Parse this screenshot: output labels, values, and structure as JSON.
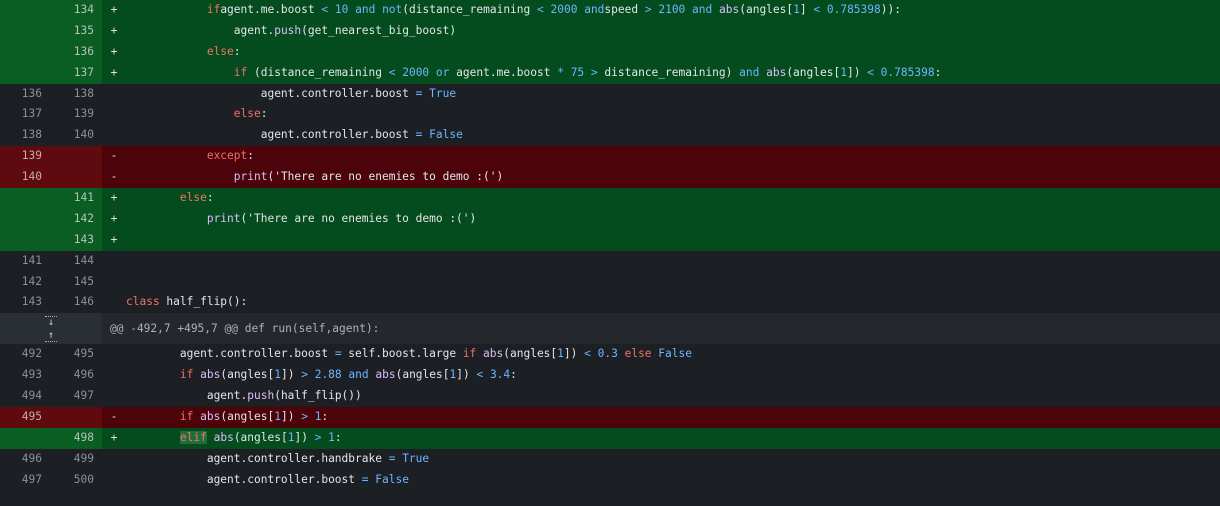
{
  "diff": {
    "rows": [
      {
        "type": "add",
        "old": "",
        "new": "134",
        "mark": "+",
        "ind": "            ",
        "toks": [
          [
            "kw",
            "if"
          ],
          [
            "",
            "agent.me.boost "
          ],
          [
            "op",
            "<"
          ],
          [
            "",
            " "
          ],
          [
            "num",
            "10"
          ],
          [
            "",
            " "
          ],
          [
            "op",
            "and"
          ],
          [
            "",
            " "
          ],
          [
            "op",
            "not"
          ],
          [
            "",
            "(distance_remaining "
          ],
          [
            "op",
            "<"
          ],
          [
            "",
            " "
          ],
          [
            "num",
            "2000"
          ],
          [
            "",
            " "
          ],
          [
            "op",
            "and"
          ],
          [
            "",
            "speed "
          ],
          [
            "op",
            ">"
          ],
          [
            "",
            " "
          ],
          [
            "num",
            "2100"
          ],
          [
            "",
            " "
          ],
          [
            "op",
            "and"
          ],
          [
            "",
            " "
          ],
          [
            "fn",
            "abs"
          ],
          [
            "",
            "(angles["
          ],
          [
            "num",
            "1"
          ],
          [
            "",
            "] "
          ],
          [
            "op",
            "<"
          ],
          [
            "",
            " "
          ],
          [
            "num",
            "0.785398"
          ],
          [
            "",
            "))"
          ],
          [
            "",
            ":"
          ]
        ]
      },
      {
        "type": "add",
        "old": "",
        "new": "135",
        "mark": "+",
        "ind": "                ",
        "toks": [
          [
            "",
            "agent."
          ],
          [
            "fn",
            "push"
          ],
          [
            "",
            "(get_nearest_big_boost)"
          ]
        ]
      },
      {
        "type": "add",
        "old": "",
        "new": "136",
        "mark": "+",
        "ind": "            ",
        "toks": [
          [
            "kw",
            "else"
          ],
          [
            "",
            ":"
          ]
        ]
      },
      {
        "type": "add",
        "old": "",
        "new": "137",
        "mark": "+",
        "ind": "                ",
        "toks": [
          [
            "kw",
            "if"
          ],
          [
            "",
            " (distance_remaining "
          ],
          [
            "op",
            "<"
          ],
          [
            "",
            " "
          ],
          [
            "num",
            "2000"
          ],
          [
            "",
            " "
          ],
          [
            "op",
            "or"
          ],
          [
            "",
            " agent.me.boost "
          ],
          [
            "op",
            "*"
          ],
          [
            "",
            " "
          ],
          [
            "num",
            "75"
          ],
          [
            "",
            " "
          ],
          [
            "op",
            ">"
          ],
          [
            "",
            " distance_remaining) "
          ],
          [
            "op",
            "and"
          ],
          [
            "",
            " "
          ],
          [
            "fn",
            "abs"
          ],
          [
            "",
            "(angles["
          ],
          [
            "num",
            "1"
          ],
          [
            "",
            "]) "
          ],
          [
            "op",
            "<"
          ],
          [
            "",
            " "
          ],
          [
            "num",
            "0.785398"
          ],
          [
            "",
            ":"
          ]
        ]
      },
      {
        "type": "ctx",
        "old": "136",
        "new": "138",
        "mark": "",
        "ind": "                    ",
        "toks": [
          [
            "",
            "agent.controller.boost "
          ],
          [
            "op",
            "="
          ],
          [
            "",
            " "
          ],
          [
            "op",
            "True"
          ]
        ]
      },
      {
        "type": "ctx",
        "old": "137",
        "new": "139",
        "mark": "",
        "ind": "                ",
        "toks": [
          [
            "kw",
            "else"
          ],
          [
            "",
            ":"
          ]
        ]
      },
      {
        "type": "ctx",
        "old": "138",
        "new": "140",
        "mark": "",
        "ind": "                    ",
        "toks": [
          [
            "",
            "agent.controller.boost "
          ],
          [
            "op",
            "="
          ],
          [
            "",
            " "
          ],
          [
            "op",
            "False"
          ]
        ]
      },
      {
        "type": "del",
        "old": "139",
        "new": "",
        "mark": "-",
        "ind": "            ",
        "toks": [
          [
            "kw",
            "except"
          ],
          [
            "",
            ":"
          ]
        ]
      },
      {
        "type": "del",
        "old": "140",
        "new": "",
        "mark": "-",
        "ind": "                ",
        "toks": [
          [
            "fn",
            "print"
          ],
          [
            "",
            "('There are no enemies to demo :(')"
          ]
        ]
      },
      {
        "type": "add",
        "old": "",
        "new": "141",
        "mark": "+",
        "ind": "        ",
        "toks": [
          [
            "kw",
            "else"
          ],
          [
            "",
            ":"
          ]
        ]
      },
      {
        "type": "add",
        "old": "",
        "new": "142",
        "mark": "+",
        "ind": "            ",
        "toks": [
          [
            "fn",
            "print"
          ],
          [
            "",
            "('There are no enemies to demo :(')"
          ]
        ]
      },
      {
        "type": "add",
        "old": "",
        "new": "143",
        "mark": "+",
        "ind": "",
        "toks": []
      },
      {
        "type": "ctx",
        "old": "141",
        "new": "144",
        "mark": "",
        "ind": "",
        "toks": []
      },
      {
        "type": "ctx",
        "old": "142",
        "new": "145",
        "mark": "",
        "ind": "",
        "toks": []
      },
      {
        "type": "ctx",
        "old": "143",
        "new": "146",
        "mark": "",
        "ind": "",
        "toks": [
          [
            "kw",
            "class"
          ],
          [
            "",
            " half_flip():"
          ]
        ]
      },
      {
        "type": "hunk",
        "text": "@@ -492,7 +495,7 @@ def run(self,agent):"
      },
      {
        "type": "ctx",
        "old": "492",
        "new": "495",
        "mark": "",
        "ind": "        ",
        "toks": [
          [
            "",
            "agent.controller.boost "
          ],
          [
            "op",
            "="
          ],
          [
            "",
            " self.boost.large "
          ],
          [
            "kw",
            "if"
          ],
          [
            "",
            " "
          ],
          [
            "fn",
            "abs"
          ],
          [
            "",
            "(angles["
          ],
          [
            "num",
            "1"
          ],
          [
            "",
            "]) "
          ],
          [
            "op",
            "<"
          ],
          [
            "",
            " "
          ],
          [
            "num",
            "0.3"
          ],
          [
            "",
            " "
          ],
          [
            "kw",
            "else"
          ],
          [
            "",
            " "
          ],
          [
            "op",
            "False"
          ]
        ]
      },
      {
        "type": "ctx",
        "old": "493",
        "new": "496",
        "mark": "",
        "ind": "        ",
        "toks": [
          [
            "kw",
            "if"
          ],
          [
            "",
            " "
          ],
          [
            "fn",
            "abs"
          ],
          [
            "",
            "(angles["
          ],
          [
            "num",
            "1"
          ],
          [
            "",
            "]) "
          ],
          [
            "op",
            ">"
          ],
          [
            "",
            " "
          ],
          [
            "num",
            "2.88"
          ],
          [
            "",
            " "
          ],
          [
            "op",
            "and"
          ],
          [
            "",
            " "
          ],
          [
            "fn",
            "abs"
          ],
          [
            "",
            "(angles["
          ],
          [
            "num",
            "1"
          ],
          [
            "",
            "]) "
          ],
          [
            "op",
            "<"
          ],
          [
            "",
            " "
          ],
          [
            "num",
            "3.4"
          ],
          [
            "",
            ":"
          ]
        ]
      },
      {
        "type": "ctx",
        "old": "494",
        "new": "497",
        "mark": "",
        "ind": "            ",
        "toks": [
          [
            "",
            "agent."
          ],
          [
            "fn",
            "push"
          ],
          [
            "",
            "(half_flip())"
          ]
        ]
      },
      {
        "type": "del",
        "old": "495",
        "new": "",
        "mark": "-",
        "ind": "        ",
        "toks": [
          [
            "kw",
            "if"
          ],
          [
            "",
            " "
          ],
          [
            "fn",
            "abs"
          ],
          [
            "",
            "(angles["
          ],
          [
            "num",
            "1"
          ],
          [
            "",
            "]) "
          ],
          [
            "op",
            ">"
          ],
          [
            "",
            " "
          ],
          [
            "num",
            "1"
          ],
          [
            "",
            ":"
          ]
        ]
      },
      {
        "type": "add",
        "old": "",
        "new": "498",
        "mark": "+",
        "ind": "        ",
        "toks": [
          [
            "kw tok-hl",
            "elif"
          ],
          [
            "",
            " "
          ],
          [
            "fn",
            "abs"
          ],
          [
            "",
            "(angles["
          ],
          [
            "num",
            "1"
          ],
          [
            "",
            "]) "
          ],
          [
            "op",
            ">"
          ],
          [
            "",
            " "
          ],
          [
            "num",
            "1"
          ],
          [
            "",
            ":"
          ]
        ]
      },
      {
        "type": "ctx",
        "old": "496",
        "new": "499",
        "mark": "",
        "ind": "            ",
        "toks": [
          [
            "",
            "agent.controller.handbrake "
          ],
          [
            "op",
            "="
          ],
          [
            "",
            " "
          ],
          [
            "op",
            "True"
          ]
        ]
      },
      {
        "type": "ctx",
        "old": "497",
        "new": "500",
        "mark": "",
        "ind": "            ",
        "toks": [
          [
            "",
            "agent.controller.boost "
          ],
          [
            "op",
            "="
          ],
          [
            "",
            " "
          ],
          [
            "op",
            "False"
          ]
        ]
      }
    ],
    "expand_up_icon": "arrow-down-dotted",
    "expand_down_icon": "arrow-up-dotted",
    "colors": {
      "added": "#044b1d",
      "removed": "#4c0309",
      "context": "#1c1f23",
      "keyword": "#f47067",
      "constant": "#6cb6ff",
      "function": "#dcbdfb"
    }
  }
}
